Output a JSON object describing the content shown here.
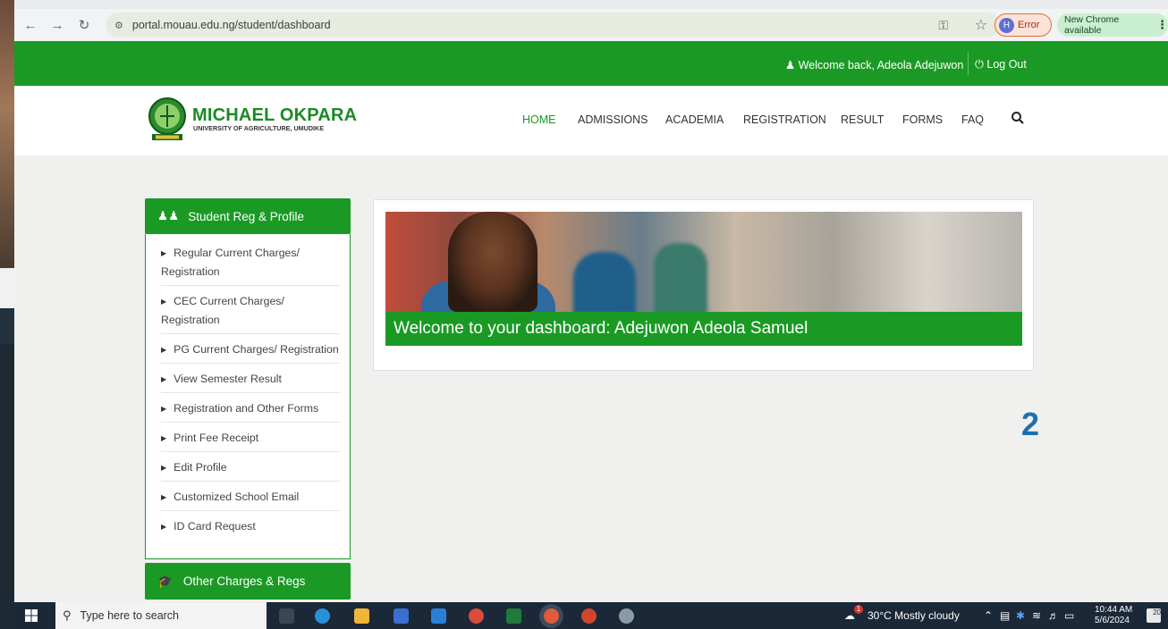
{
  "browser": {
    "url": "portal.mouau.edu.ng/student/dashboard",
    "profile_badge": "Error",
    "profile_initial": "H",
    "update_label": "New Chrome available"
  },
  "topbar": {
    "welcome": "Welcome back, Adeola Adejuwon",
    "logout": "Log Out"
  },
  "header": {
    "logo_title": "MICHAEL OKPARA",
    "logo_subtitle": "UNIVERSITY OF AGRICULTURE, UMUDIKE",
    "menu": [
      "HOME",
      "ADMISSIONS",
      "ACADEMIA",
      "REGISTRATION",
      "RESULT",
      "FORMS",
      "FAQ"
    ]
  },
  "sidebar": {
    "title": "Student Reg & Profile",
    "items": [
      {
        "label": "Regular Current Charges/ Registration"
      },
      {
        "label": "CEC Current Charges/ Registration"
      },
      {
        "label": "PG Current Charges/ Registration"
      },
      {
        "label": "View Semester Result"
      },
      {
        "label": "Registration and Other Forms"
      },
      {
        "label": "Print Fee Receipt"
      },
      {
        "label": "Edit Profile"
      },
      {
        "label": "Customized School Email"
      },
      {
        "label": "ID Card Request"
      }
    ],
    "second_title": "Other Charges & Regs"
  },
  "main": {
    "welcome": "Welcome to your dashboard: Adejuwon Adeola Samuel"
  },
  "annotation": "2",
  "taskbar": {
    "search_placeholder": "Type here to search",
    "weather": "30°C  Mostly cloudy",
    "time": "10:44 AM",
    "date": "5/6/2024",
    "notification_count": "20",
    "weather_badge": "1"
  },
  "colors": {
    "brand_green": "#1a9a24",
    "annotation_blue": "#1f6fb0"
  }
}
